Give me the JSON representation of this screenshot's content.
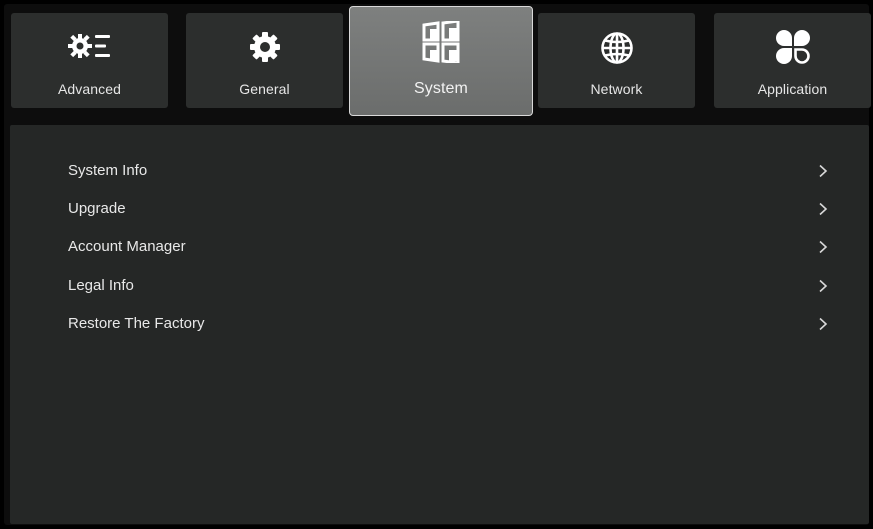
{
  "tabs": [
    {
      "id": "advanced",
      "label": "Advanced",
      "icon": "gear-list-icon",
      "selected": false
    },
    {
      "id": "general",
      "label": "General",
      "icon": "gear-icon",
      "selected": false
    },
    {
      "id": "system",
      "label": "System",
      "icon": "system-windows-icon",
      "selected": true
    },
    {
      "id": "network",
      "label": "Network",
      "icon": "globe-icon",
      "selected": false
    },
    {
      "id": "application",
      "label": "Application",
      "icon": "apps-icon",
      "selected": false
    }
  ],
  "menu": {
    "items": [
      {
        "label": "System Info",
        "icon": "chevron-right-icon"
      },
      {
        "label": "Upgrade",
        "icon": "chevron-right-icon"
      },
      {
        "label": "Account Manager",
        "icon": "chevron-right-icon"
      },
      {
        "label": "Legal Info",
        "icon": "chevron-right-icon"
      },
      {
        "label": "Restore The Factory",
        "icon": "chevron-right-icon"
      }
    ]
  },
  "colors": {
    "background": "#000000",
    "tab_bg": "#2c2e2d",
    "tab_selected_bg": "#747675",
    "panel_bg": "#252726",
    "text": "#e8e8e8"
  }
}
